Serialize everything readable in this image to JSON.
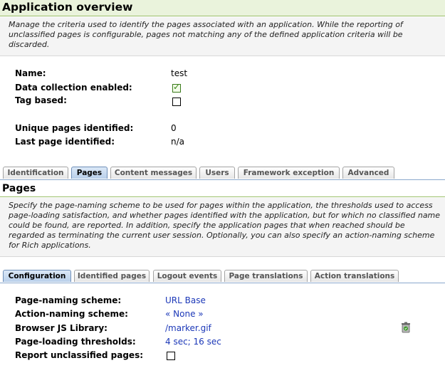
{
  "header": {
    "title": "Application overview"
  },
  "overview_description": "Manage the criteria used to identify the pages associated with an application. While the reporting of unclassified pages is configurable, pages not matching any of the defined application criteria will be discarded.",
  "app": {
    "name_label": "Name:",
    "name_value": "test",
    "data_collection_label": "Data collection enabled:",
    "data_collection_checked": true,
    "tag_based_label": "Tag based:",
    "tag_based_checked": false,
    "unique_pages_label": "Unique pages identified:",
    "unique_pages_value": "0",
    "last_page_label": "Last page identified:",
    "last_page_value": "n/a"
  },
  "main_tabs": [
    "Identification",
    "Pages",
    "Content messages",
    "Users",
    "Framework exception",
    "Advanced"
  ],
  "main_tabs_active": "Pages",
  "pages_section": {
    "title": "Pages",
    "description": "Specify the page-naming scheme to be used for pages within the application, the thresholds used to access page-loading satisfaction, and whether pages identified with the application, but for which no classified name could be found, are reported. In addition, specify the application pages that when reached should be regarded as terminating the current user session. Optionally, you can also specify an action-naming scheme for Rich applications."
  },
  "sub_tabs": [
    "Configuration",
    "Identified pages",
    "Logout events",
    "Page translations",
    "Action translations"
  ],
  "sub_tabs_active": "Configuration",
  "config": {
    "page_naming_label": "Page-naming scheme:",
    "page_naming_value": "URL Base",
    "action_naming_label": "Action-naming scheme:",
    "action_naming_value": "« None »",
    "browser_js_label": "Browser JS Library:",
    "browser_js_value": "/marker.gif",
    "thresholds_label": "Page-loading thresholds:",
    "thresholds_value": "4 sec; 16 sec",
    "report_unclassified_label": "Report unclassified pages:",
    "report_unclassified_checked": false
  },
  "icons": {
    "delete": "trash-icon"
  },
  "colors": {
    "link": "#1c38b8",
    "header_bg": "#eaf3dc",
    "active_tab": "#b8cfea"
  }
}
